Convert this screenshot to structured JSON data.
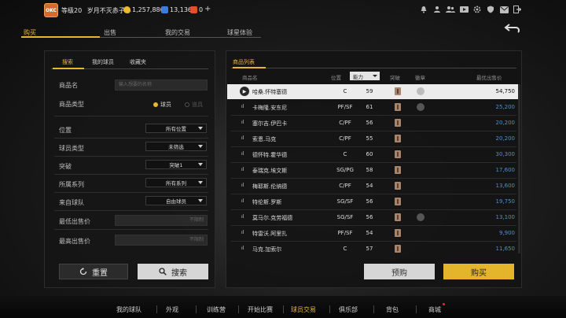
{
  "topbar": {
    "avatar_label": "OKC",
    "level_text": "等级20",
    "username": "岁月不灭赤子心",
    "coins": "1,257,886",
    "gems": "13,136",
    "tickets": "0",
    "plus": "+",
    "icons": [
      "bell-icon",
      "person-icon",
      "group-icon",
      "video-icon",
      "settings-icon",
      "shield-icon",
      "mail-icon",
      "exit-icon"
    ]
  },
  "main_tabs": [
    {
      "label": "购买",
      "active": true
    },
    {
      "label": "出售",
      "active": false
    },
    {
      "label": "我的交易",
      "active": false
    },
    {
      "label": "球星体验",
      "active": false
    }
  ],
  "left_panel": {
    "tabs": [
      {
        "label": "搜索",
        "active": true
      },
      {
        "label": "我的球员",
        "active": false
      },
      {
        "label": "收藏夹",
        "active": false
      }
    ],
    "name_label": "商品名",
    "name_placeholder": "输入想要的名称",
    "type_label": "商品类型",
    "type_options": [
      {
        "label": "球员",
        "selected": true
      },
      {
        "label": "道具",
        "selected": false
      }
    ],
    "filters": [
      {
        "label": "位置",
        "value": "所有位置"
      },
      {
        "label": "球员类型",
        "value": "未筛选"
      },
      {
        "label": "突破",
        "value": "突破1"
      },
      {
        "label": "所属系列",
        "value": "所有系列"
      },
      {
        "label": "来自球队",
        "value": "自由球员"
      }
    ],
    "min_price_label": "最低出售价",
    "min_price_placeholder": "不限制",
    "max_price_label": "最高出售价",
    "max_price_placeholder": "不限制",
    "reset_label": "重置",
    "search_label": "搜索"
  },
  "right_panel": {
    "tab_label": "商品列表",
    "headers": {
      "name": "商品名",
      "position": "位置",
      "sort": "能力",
      "breakthrough": "突破",
      "badge": "徽章",
      "price": "最优出售价"
    },
    "rows": [
      {
        "name": "哈桑.怀特塞德",
        "position": "C",
        "rating": "59",
        "price": "54,750",
        "badge": true,
        "selected": true
      },
      {
        "name": "卡梅隆.安东尼",
        "position": "PF/SF",
        "rating": "61",
        "price": "25,200",
        "badge": true,
        "selected": false
      },
      {
        "name": "塞尔吉.伊巴卡",
        "position": "C/PF",
        "rating": "56",
        "price": "20,200",
        "badge": false,
        "selected": false
      },
      {
        "name": "索恩.马克",
        "position": "C/PF",
        "rating": "55",
        "price": "20,200",
        "badge": false,
        "selected": false
      },
      {
        "name": "德怀特.霍华德",
        "position": "C",
        "rating": "60",
        "price": "30,300",
        "badge": false,
        "selected": false
      },
      {
        "name": "泰瑞克.埃文斯",
        "position": "SG/PG",
        "rating": "58",
        "price": "17,600",
        "badge": false,
        "selected": false
      },
      {
        "name": "梅耶斯.伦纳德",
        "position": "C/PF",
        "rating": "54",
        "price": "13,600",
        "badge": false,
        "selected": false
      },
      {
        "name": "特伦斯.罗斯",
        "position": "SG/SF",
        "rating": "56",
        "price": "19,750",
        "badge": false,
        "selected": false
      },
      {
        "name": "莫马尔.克劳福德",
        "position": "SG/SF",
        "rating": "56",
        "price": "13,100",
        "badge": true,
        "selected": false
      },
      {
        "name": "特雷沃.阿里扎",
        "position": "PF/SF",
        "rating": "54",
        "price": "9,900",
        "badge": false,
        "selected": false
      },
      {
        "name": "马克.加索尔",
        "position": "C",
        "rating": "57",
        "price": "11,650",
        "badge": false,
        "selected": false
      }
    ],
    "buy_order_label": "预购",
    "buy_label": "购买"
  },
  "bottom_nav": [
    {
      "label": "我的球队",
      "active": false
    },
    {
      "label": "外观",
      "active": false
    },
    {
      "label": "训练营",
      "active": false
    },
    {
      "label": "开始比赛",
      "active": false
    },
    {
      "label": "球员交易",
      "active": true
    },
    {
      "label": "俱乐部",
      "active": false
    },
    {
      "label": "背包",
      "active": false
    },
    {
      "label": "商城",
      "active": false
    }
  ]
}
